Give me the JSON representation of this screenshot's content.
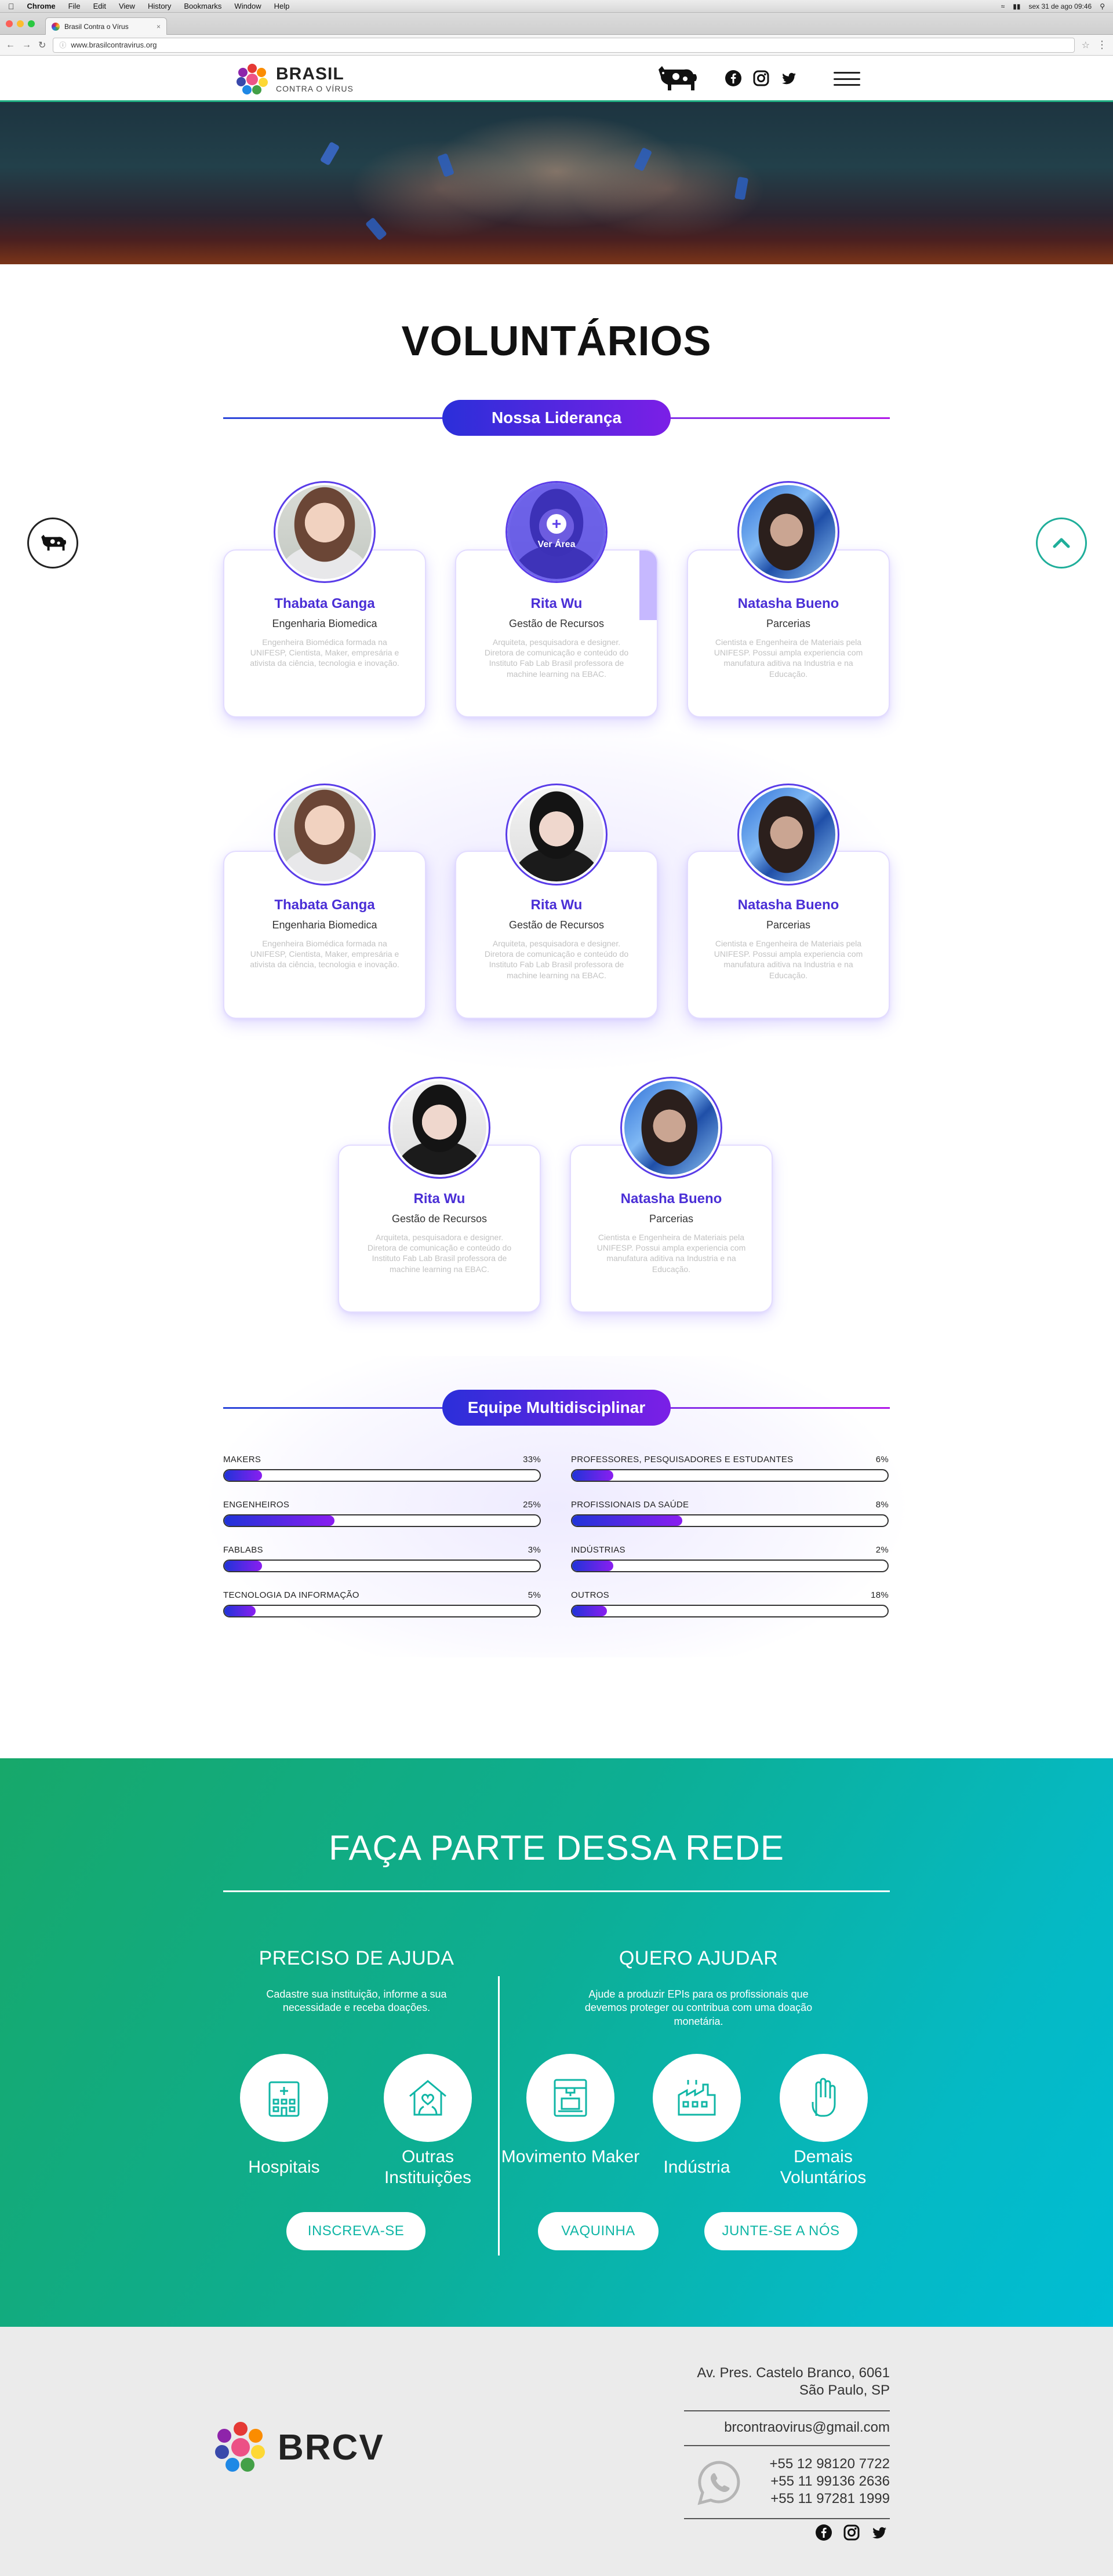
{
  "menubar": {
    "app": "Chrome",
    "items": [
      "File",
      "Edit",
      "View",
      "History",
      "Bookmarks",
      "Window",
      "Help"
    ],
    "clock": "sex 31 de ago  09:46"
  },
  "browser": {
    "tab_title": "Brasil Contra o Vírus",
    "url": "www.brasilcontravirus.org"
  },
  "header": {
    "logo_big": "BRASIL",
    "logo_small": "CONTRA O VÍRUS",
    "social": [
      "facebook-icon",
      "instagram-icon",
      "twitter-icon"
    ]
  },
  "page": {
    "title": "VOLUNTÁRIOS"
  },
  "leadership": {
    "pill": "Nossa Liderança",
    "hover_label": "Ver Área",
    "people": [
      {
        "name": "Thabata Ganga",
        "role": "Engenharia Biomedica",
        "desc": "Engenheira Biomédica formada na UNIFESP, Cientista, Maker, empresária e ativista da ciência, tecnologia e inovação."
      },
      {
        "name": "Rita Wu",
        "role": "Gestão de Recursos",
        "desc": "Arquiteta, pesquisadora e designer. Diretora de comunicação e conteúdo do Instituto Fab Lab Brasil professora de machine learning na EBAC."
      },
      {
        "name": "Natasha Bueno",
        "role": "Parcerias",
        "desc": "Cientista e Engenheira de Materiais pela UNIFESP. Possui ampla experiencia com manufatura aditiva na Industria e na Educação."
      },
      {
        "name": "Thabata Ganga",
        "role": "Engenharia Biomedica",
        "desc": "Engenheira Biomédica formada na UNIFESP, Cientista, Maker, empresária e ativista da ciência, tecnologia e inovação."
      },
      {
        "name": "Rita Wu",
        "role": "Gestão de Recursos",
        "desc": "Arquiteta, pesquisadora e designer. Diretora de comunicação e conteúdo do Instituto Fab Lab Brasil professora de machine learning na EBAC."
      },
      {
        "name": "Natasha Bueno",
        "role": "Parcerias",
        "desc": "Cientista e Engenheira de Materiais pela UNIFESP. Possui ampla experiencia com manufatura aditiva na Industria e na Educação."
      },
      {
        "name": "Rita Wu",
        "role": "Gestão de Recursos",
        "desc": "Arquiteta, pesquisadora e designer. Diretora de comunicação e conteúdo do Instituto Fab Lab Brasil professora de machine learning na EBAC."
      },
      {
        "name": "Natasha Bueno",
        "role": "Parcerias",
        "desc": "Cientista e Engenheira de Materiais pela UNIFESP. Possui ampla experiencia com manufatura aditiva na Industria e na Educação."
      }
    ]
  },
  "team": {
    "pill": "Equipe Multidisciplinar",
    "bars": [
      {
        "label": "MAKERS",
        "pct_text": "33%",
        "fraction": 0.12
      },
      {
        "label": "PROFESSORES, PESQUISADORES E ESTUDANTES",
        "pct_text": "6%",
        "fraction": 0.13
      },
      {
        "label": "ENGENHEIROS",
        "pct_text": "25%",
        "fraction": 0.35
      },
      {
        "label": "PROFISSIONAIS DA SAÚDE",
        "pct_text": "8%",
        "fraction": 0.35
      },
      {
        "label": "FABLABS",
        "pct_text": "3%",
        "fraction": 0.12
      },
      {
        "label": "INDÚSTRIAS",
        "pct_text": "2%",
        "fraction": 0.13
      },
      {
        "label": "TECNOLOGIA DA INFORMAÇÃO",
        "pct_text": "5%",
        "fraction": 0.1
      },
      {
        "label": "OUTROS",
        "pct_text": "18%",
        "fraction": 0.11
      }
    ]
  },
  "cta": {
    "title": "FAÇA PARTE DESSA REDE",
    "left": {
      "heading": "PRECISO DE AJUDA",
      "text": "Cadastre sua instituição, informe a sua necessidade e receba doações.",
      "items": [
        "Hospitais",
        "Outras Instituições"
      ],
      "button": "INSCREVA-SE"
    },
    "right": {
      "heading": "QUERO AJUDAR",
      "text": "Ajude a produzir EPIs para os profissionais que devemos proteger ou contribua com uma doação monetária.",
      "items": [
        "Movimento Maker",
        "Indústria",
        "Demais Voluntários"
      ],
      "buttons": [
        "VAQUINHA",
        "JUNTE-SE A NÓS"
      ]
    }
  },
  "footer": {
    "brand": "BRCV",
    "address1": "Av. Pres. Castelo Branco, 6061",
    "address2": "São Paulo, SP",
    "email": "brcontraovirus@gmail.com",
    "phones": [
      "+55 12 98120 7722",
      "+55 11 99136 2636",
      "+55 11 97281 1999"
    ]
  },
  "colors": {
    "accent_purple": "#4a2fd6",
    "accent_green": "#1fae82",
    "cta_teal": "#05b9c4"
  }
}
